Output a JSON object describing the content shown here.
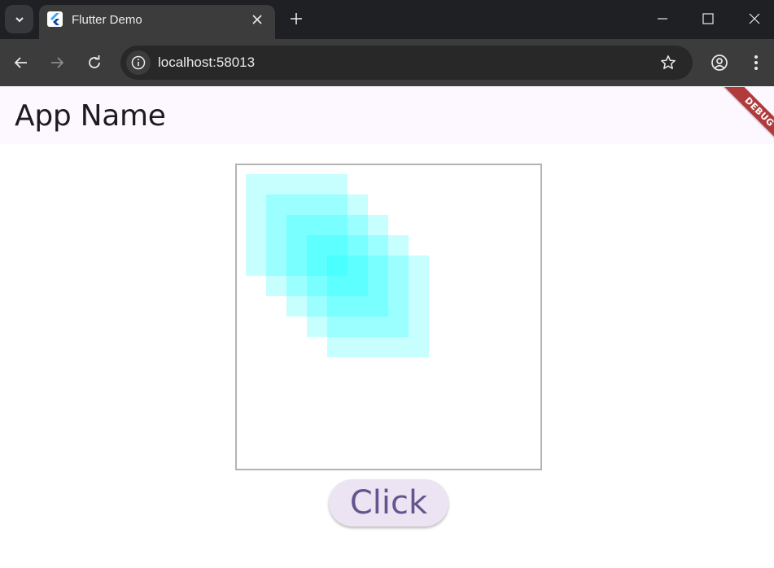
{
  "browser": {
    "tab": {
      "title": "Flutter Demo"
    },
    "address_bar": {
      "url": "localhost:58013"
    }
  },
  "app": {
    "title": "App Name",
    "debug_banner": "DEBUG",
    "canvas": {
      "square_color": "#00ffff",
      "square_count": 5
    },
    "button": {
      "label": "Click"
    }
  },
  "colors": {
    "appbar_bg": "#fdf7ff",
    "button_bg": "#ece4f2",
    "button_text": "#65558f",
    "debug_ribbon": "#b13b3b"
  },
  "icons": {
    "tab_search": "chevron-down-icon",
    "favicon": "flutter-logo-icon",
    "tab_close": "close-icon",
    "new_tab": "plus-icon",
    "minimize": "minimize-icon",
    "maximize": "maximize-icon",
    "window_close": "close-icon",
    "back": "arrow-left-icon",
    "forward": "arrow-right-icon",
    "reload": "reload-icon",
    "site_info": "info-icon",
    "bookmark": "star-icon",
    "profile": "account-icon",
    "menu": "more-vertical-icon"
  }
}
